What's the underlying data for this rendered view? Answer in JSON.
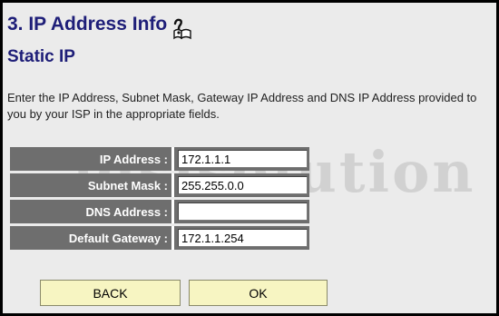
{
  "header": {
    "title": "3. IP Address Info",
    "help_icon": "help-question-book-icon",
    "subtitle": "Static IP"
  },
  "description": "Enter the IP Address, Subnet Mask, Gateway IP Address and DNS IP Address provided to you by your ISP in the appropriate fields.",
  "watermark": "adslsolution",
  "form": {
    "rows": [
      {
        "label": "IP Address :",
        "value": "172.1.1.1"
      },
      {
        "label": "Subnet Mask :",
        "value": "255.255.0.0"
      },
      {
        "label": "DNS Address :",
        "value": ""
      },
      {
        "label": "Default Gateway :",
        "value": "172.1.1.254"
      }
    ]
  },
  "buttons": {
    "back": "BACK",
    "ok": "OK"
  },
  "colors": {
    "title_text": "#1e1e78",
    "label_bg": "#6e6e6e",
    "page_bg": "#ebebeb",
    "button_bg": "#f7f5c2"
  }
}
